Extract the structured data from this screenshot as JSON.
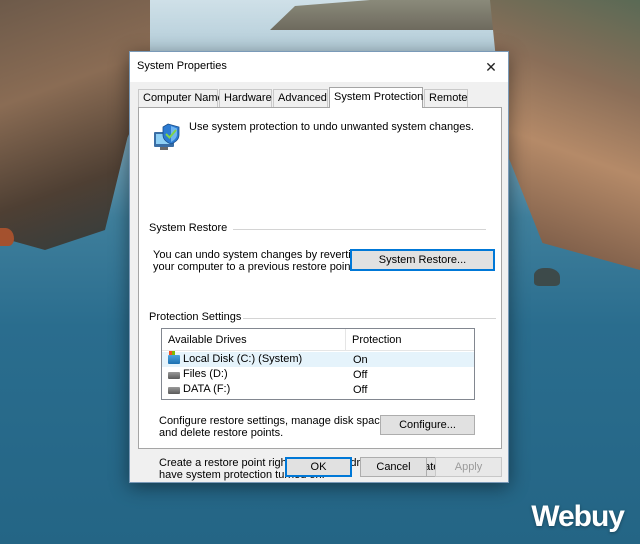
{
  "window": {
    "title": "System Properties",
    "close_glyph": "✕"
  },
  "tabs": [
    {
      "label": "Computer Name"
    },
    {
      "label": "Hardware"
    },
    {
      "label": "Advanced"
    },
    {
      "label": "System Protection",
      "active": true
    },
    {
      "label": "Remote"
    }
  ],
  "intro": {
    "text": "Use system protection to undo unwanted system changes.",
    "icon": "system-shield-icon"
  },
  "system_restore": {
    "group_label": "System Restore",
    "description_line1": "You can undo system changes by reverting",
    "description_line2": "your computer to a previous restore point.",
    "button_label": "System Restore..."
  },
  "protection": {
    "group_label": "Protection Settings",
    "columns": [
      "Available Drives",
      "Protection"
    ],
    "drives": [
      {
        "name": "Local Disk (C:) (System)",
        "protection": "On",
        "icon": "system-drive-icon",
        "selected": true
      },
      {
        "name": "Files (D:)",
        "protection": "Off",
        "icon": "drive-icon",
        "selected": false
      },
      {
        "name": "DATA (F:)",
        "protection": "Off",
        "icon": "drive-icon",
        "selected": false
      }
    ],
    "configure_line1": "Configure restore settings, manage disk space,",
    "configure_line2": "and delete restore points.",
    "configure_button": "Configure...",
    "create_line1": "Create a restore point right now for the drives that",
    "create_line2": "have system protection turned on.",
    "create_button": "Create..."
  },
  "footer": {
    "ok": "OK",
    "cancel": "Cancel",
    "apply": "Apply"
  },
  "watermark": "Webuy",
  "colors": {
    "focus_border": "#0078d7",
    "selected_row": "#e5f3fb",
    "disabled_text": "#9b9b9b"
  }
}
